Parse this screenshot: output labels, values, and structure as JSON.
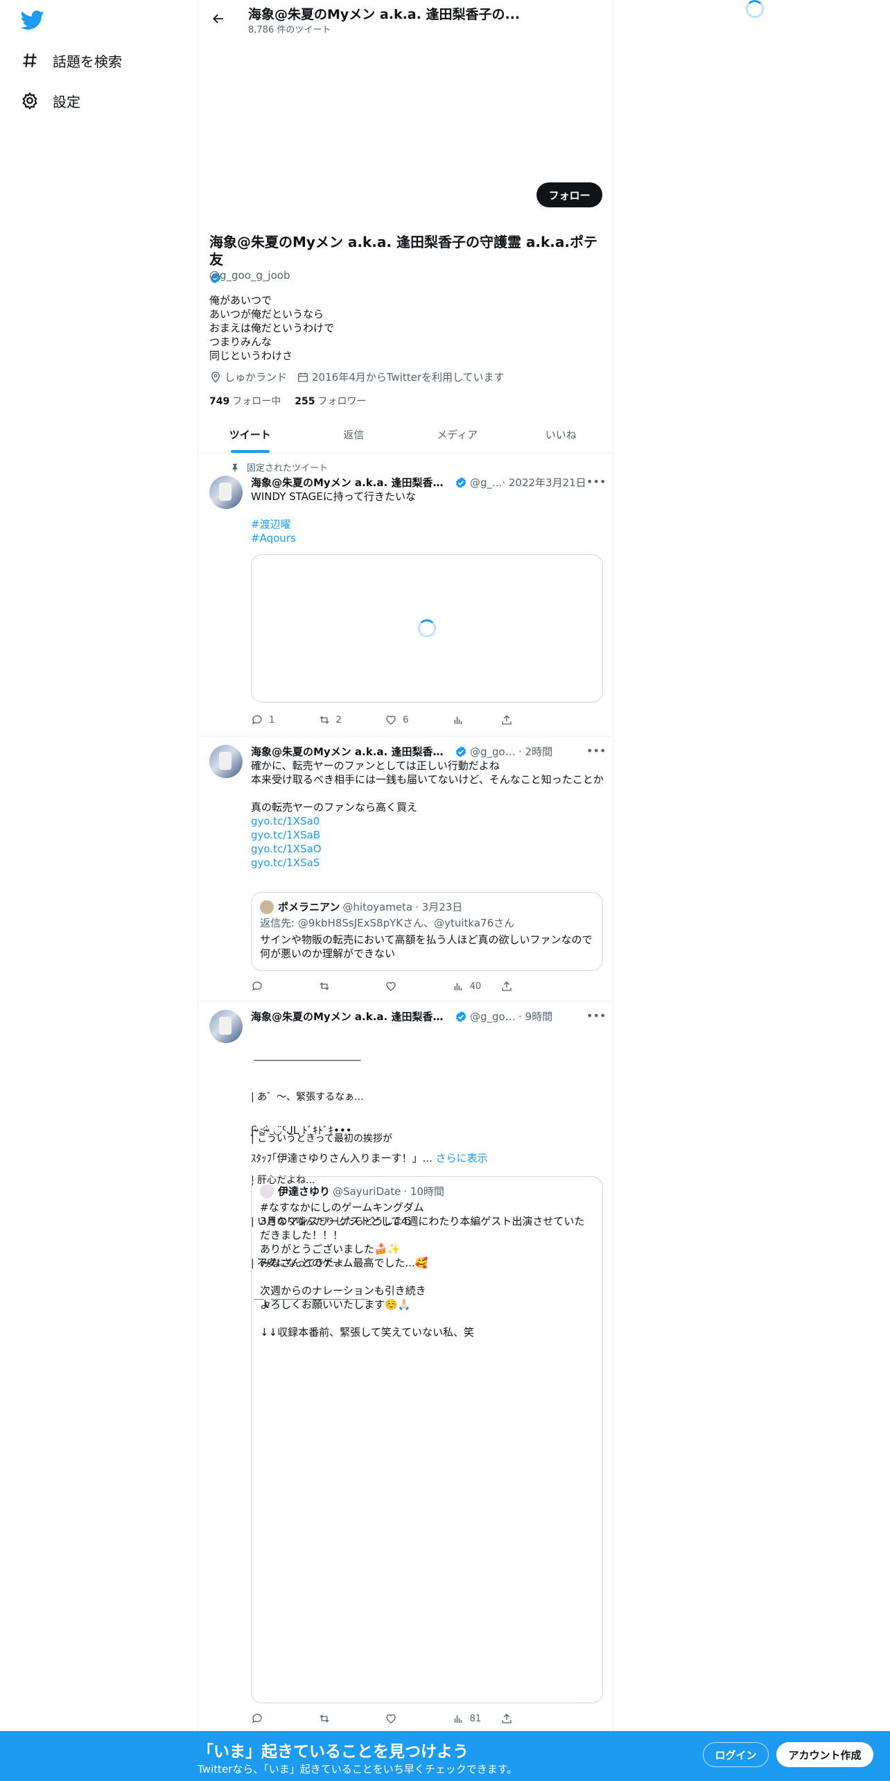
{
  "nav": {
    "items": [
      {
        "label": "話題を検索",
        "icon": "hashtag-icon"
      },
      {
        "label": "設定",
        "icon": "gear-icon"
      }
    ]
  },
  "header": {
    "name": "海象@朱夏のMyメン a.k.a. 逢田梨香子の...",
    "tweet_count": "8,786 件のツイート"
  },
  "profile": {
    "follow_label": "フォロー",
    "name": "海象@朱夏のMyメン a.k.a. 逢田梨香子の守護霊 a.k.a.ポテ友",
    "handle": "@g_goo_g_joob",
    "bio": [
      "俺があいつで",
      "あいつが俺だというなら",
      "おまえは俺だというわけで",
      "つまりみんな",
      "同じというわけさ"
    ],
    "location": "しゅかランド",
    "joined": "2016年4月からTwitterを利用しています",
    "following_count": "749",
    "following_label": "フォロー中",
    "followers_count": "255",
    "followers_label": "フォロワー"
  },
  "tabs": [
    "ツイート",
    "返信",
    "メディア",
    "いいね"
  ],
  "tweets": [
    {
      "pinned_label": "固定されたツイート",
      "name": "海象@朱夏のMyメン a.k.a. 逢田梨香子...",
      "handle": "@g_...",
      "time": "· 2022年3月21日",
      "text": [
        "WINDY STAGEに持って行きたいな",
        "",
        "#渡辺曜",
        "#Aqours"
      ],
      "replies": "1",
      "retweets": "2",
      "likes": "6"
    },
    {
      "name": "海象@朱夏のMyメン a.k.a. 逢田梨香子の守...",
      "handle": "@g_goo...",
      "time": "· 2時間",
      "text": [
        "確かに、転売ヤーのファンとしては正しい行動だよね",
        "本来受け取るべき相手には一銭も届いてないけど、そんなこと知ったことか",
        "",
        "真の転売ヤーのファンなら高く買え"
      ],
      "links": [
        "gyo.tc/1XSa0",
        "gyo.tc/1XSaB",
        "gyo.tc/1XSaO",
        "gyo.tc/1XSaS"
      ],
      "quote": {
        "name": "ポメラニアン",
        "handle": "@hitoyameta",
        "time": "· 3月23日",
        "reply_to": "返信先: @9kbH8SsJExS8pYKさん、@ytuitka76さん",
        "text": [
          "サインや物販の転売において高額を払う人ほど真の欲しいファンなので",
          "何が悪いのか理解ができない"
        ]
      },
      "views": "40"
    },
    {
      "name": "海象@朱夏のMyメン a.k.a. 逢田梨香子の守...",
      "handle": "@g_goo...",
      "time": "· 9時間",
      "aa": [
        " ______________________",
        "| あ゛〜、緊張するなぁ...",
        "| こういうときって最初の挨拶が",
        "| 肝心だよね...",
        "| いきなり噛んだりしたらどうしよう",
        "| 不安になってきたよ...",
        " ￣∨￣￣￣￣￣￣￣￣￣￣"
      ],
      "line1": "ʃᵕ̴̀ಎ́ᵕ̴̀ ◡̈ᑦᒍᒪ ﾄﾞｷﾄﾞｷ•••",
      "line2": "ｽﾀｯﾌ｢伊達さゆりさん入りまーす！」...",
      "show_more": "さらに表示",
      "quote": {
        "name": "伊達さゆり",
        "handle": "@SayuriDate",
        "time": "· 10時間",
        "text": [
          "#なすなかにしのゲームキングダム",
          "3月のマンスリーゲストとして4週にわたり本編ゲスト出演させていた",
          "だきました！！！",
          "ありがとうございました🍰✨",
          "みなさんとのゲーム最高でした...🥰",
          "",
          "次週からのナレーションも引き続き",
          "よろしくお願いいたします☺️🙏🏻",
          "",
          "↓↓収録本番前、緊張して笑えていない私、笑"
        ]
      },
      "views": "81"
    }
  ],
  "bottom": {
    "title": "「いま」起きていることを見つけよう",
    "subtitle": "Twitterなら、「いま」起きていることをいち早くチェックできます。",
    "login": "ログイン",
    "signup": "アカウント作成"
  },
  "colors": {
    "accent": "#1d9bf0",
    "text": "#0f1419",
    "muted": "#536471"
  }
}
